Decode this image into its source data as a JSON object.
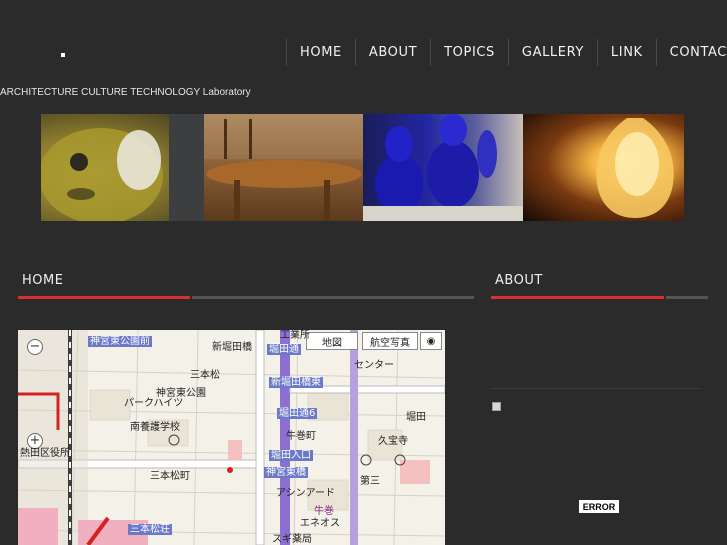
{
  "nav": {
    "items": [
      {
        "label": "HOME"
      },
      {
        "label": "ABOUT"
      },
      {
        "label": "TOPICS"
      },
      {
        "label": "GALLERY"
      },
      {
        "label": "LINK"
      },
      {
        "label": "CONTACT"
      }
    ]
  },
  "header": {
    "tagline": "ARCHITECTURE CULTURE TECHNOLOGY Laboratory"
  },
  "banner": {
    "images": [
      {
        "icon": "pufferfish-lantern-image"
      },
      {
        "icon": "wooden-table-image"
      },
      {
        "icon": "blue-glass-bottles-image"
      },
      {
        "icon": "amber-lamp-image"
      }
    ]
  },
  "main": {
    "title": "HOME",
    "accent_color": "#e03131",
    "rule_color": "#5a5a5a"
  },
  "sidebar": {
    "title": "ABOUT",
    "error_label": "ERROR"
  },
  "map": {
    "buttons": {
      "map": "地図",
      "aerial": "航空写真"
    },
    "labels": {
      "jingu_park_front": "神宮東公園前",
      "horita_street": "堀田通",
      "industrial": "工業所",
      "shin_horita_bridge": "新堀田橋",
      "shin_horita_east": "新堀田橋東",
      "horita_6": "堀田通6",
      "horita_entrance": "堀田入口",
      "jingu_higashi_bridge": "神宮東橋",
      "atsuta_ward_office": "熱田区役所",
      "jingu_east_park": "神宮東公園",
      "parkheights": "パークハイツ",
      "minamiyogo_school": "南養護学校",
      "sanbonmatsu": "三本松",
      "sanbonmatsu_town": "三本松町",
      "sanbonmatsu_so": "三本松荘",
      "gyukanmachi": "牛巻町",
      "gyukan": "牛巻",
      "asian_ard": "アシンアード",
      "kyuhoji": "久宝寺",
      "hotta_kanji": "堀田",
      "daisan": "第三",
      "eneos": "エネオス",
      "sugi": "スギ薬局",
      "center": "センター"
    }
  }
}
